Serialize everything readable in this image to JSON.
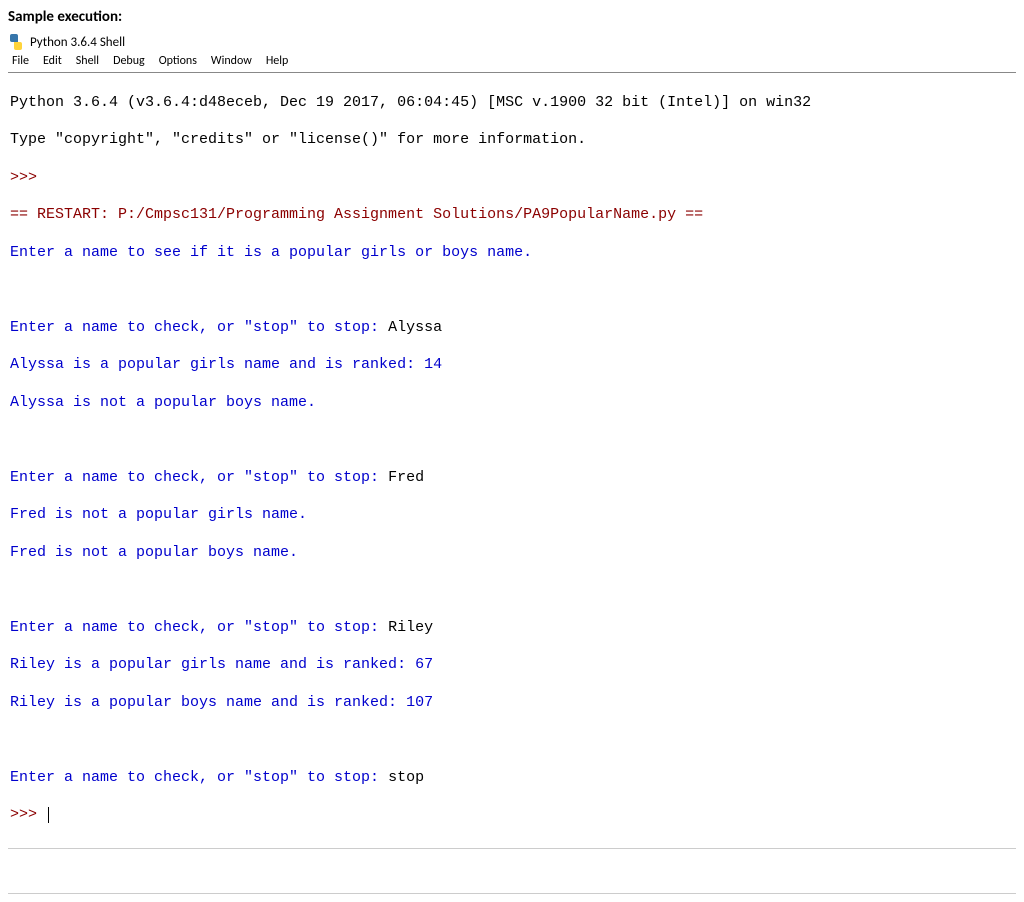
{
  "header": {
    "label": "Sample execution:"
  },
  "window": {
    "title": "Python 3.6.4 Shell"
  },
  "menu": {
    "items": [
      "File",
      "Edit",
      "Shell",
      "Debug",
      "Options",
      "Window",
      "Help"
    ]
  },
  "console": {
    "banner1": "Python 3.6.4 (v3.6.4:d48eceb, Dec 19 2017, 06:04:45) [MSC v.1900 32 bit (Intel)] on win32",
    "banner2": "Type \"copyright\", \"credits\" or \"license()\" for more information.",
    "prompt": ">>>",
    "restart": "== RESTART: P:/Cmpsc131/Programming Assignment Solutions/PA9PopularName.py ==",
    "lines": [
      "Enter a name to see if it is a popular girls or boys name.",
      "",
      "Enter a name to check, or \"stop\" to stop: ",
      "Alyssa is a popular girls name and is ranked: 14",
      "Alyssa is not a popular boys name.",
      "",
      "Enter a name to check, or \"stop\" to stop: ",
      "Fred is not a popular girls name.",
      "Fred is not a popular boys name.",
      "",
      "Enter a name to check, or \"stop\" to stop: ",
      "Riley is a popular girls name and is ranked: 67",
      "Riley is a popular boys name and is ranked: 107",
      "",
      "Enter a name to check, or \"stop\" to stop: "
    ],
    "inputs": {
      "input1": "Alyssa",
      "input2": "Fred",
      "input3": "Riley",
      "input4": "stop"
    },
    "final_prompt": ">>> "
  }
}
